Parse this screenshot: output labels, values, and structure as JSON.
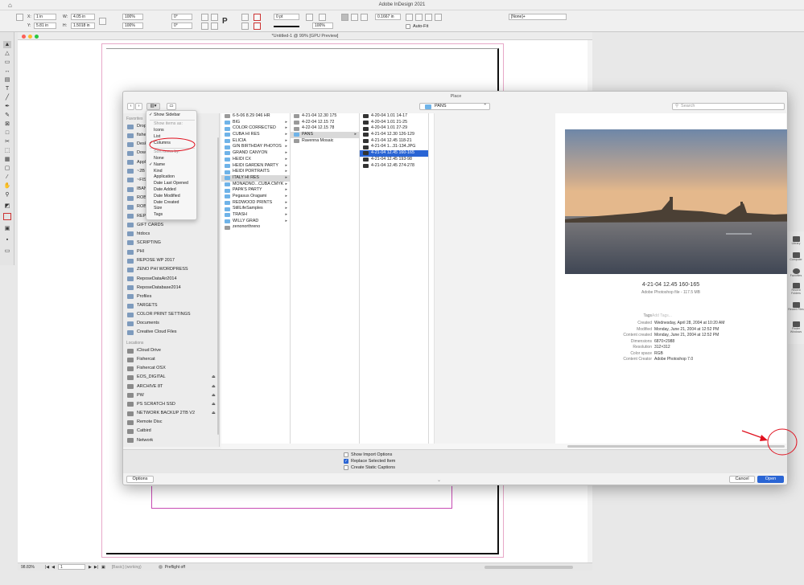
{
  "app": {
    "title": "Adobe InDesign 2021"
  },
  "control": {
    "x": "1 in",
    "y": "5.81 in",
    "w": "4.05 in",
    "h": "1.5018 in",
    "scale_x": "100%",
    "scale_y": "100%",
    "rotate": "0°",
    "shear": "0°",
    "stroke_weight": "0 pt",
    "opacity": "100%",
    "gap": "0.1667 in",
    "style": "[None]+",
    "auto_fit": "Auto-Fit"
  },
  "document": {
    "title": "*Untitled-1 @ 99% [GPU Preview]"
  },
  "status": {
    "zoom": "98.83%",
    "page": "1",
    "style": "[Basic] (working)",
    "preflight": "Preflight off"
  },
  "right_panel": {
    "items": [
      "Library",
      "Computer",
      "Favorites",
      "Recent Folders",
      "Recent Files",
      "Finder Windows"
    ]
  },
  "dialog": {
    "title": "Place",
    "path_popup": "PANS",
    "search_placeholder": "Search",
    "nav": {
      "back": "‹",
      "forward": "›"
    },
    "sidebar": {
      "favorites_header": "Favorites",
      "favorites": [
        "Dropbox",
        "fishercat",
        "Desktop",
        "Downloads",
        "Applications",
        "~2B",
        "~FISHERCAT",
        "IBANEZ",
        "ROBERTS",
        "ROBERTS",
        "REPOSE",
        "GIFT CARDS",
        "htdocs",
        "SCRIPTING",
        "PHI",
        "REPOSE WP 2017",
        "ZENO PHI WORDPRESS",
        "ReposeDataAir2014",
        "ReposeDatabase2014",
        "Profiles",
        "TARGETS",
        "COLOR PRINT SETTINGS",
        "Documents",
        "Creative Cloud Files"
      ],
      "locations_header": "Locations",
      "locations": [
        "iCloud Drive",
        "Fishercat",
        "Fishercat OSX",
        "EOS_DIGITAL",
        "ARCHIVE 8T",
        "PW",
        "PS SCRATCH SSD",
        "NETWORK BACKUP 2TB V2",
        "Remote Disc",
        "Catbird",
        "Network"
      ]
    },
    "col1": [
      "6-5-06 8.29 046 HR",
      "BIG",
      "COLOR CORRECTED",
      "CUBA HI RES",
      "ELICIA",
      "GIN BIRTHDAY PHOTOS",
      "GRAND CANYON",
      "HEIDI CX",
      "HEIDI GARDEN PARTY",
      "HEIDI PORTRAITS",
      "ITALY HI RES",
      "MONADNO...CUBA CMYK",
      "PAPA'S PARTY",
      "Pegasus Oragami",
      "REDWOOD PRINTS",
      "StillLifeSamples",
      "TRASH",
      "WILLY GRAD",
      "zenonorthreno"
    ],
    "col2": [
      "4-21-04 12.30 175",
      "4-22-04 12.15 72",
      "4-22-04 12.15 78",
      "PANS",
      "Ravenna Mosaic"
    ],
    "col3": [
      "4-20-04 1.01 14-17",
      "4-20-04 1.01 21-25",
      "4-20-04 1.01 27-29",
      "4-21-04 12.30 126-129",
      "4-21-04 12.45 118-21",
      "4-21-04 1...31-134.JPG",
      "4-21-04 12.45 160-165",
      "4-21-04 12.45 193-98",
      "4-21-04 12.45 274-278"
    ],
    "preview": {
      "name": "4-21-04 12.45 160-165",
      "kind": "Adobe Photoshop file - 117.5 MB",
      "tags_label": "Tags",
      "tags_placeholder": "Add Tags...",
      "meta": [
        [
          "Created",
          "Wednesday, April 28, 2004 at 10:20 AM"
        ],
        [
          "Modified",
          "Monday, June 21, 2004 at 12:52 PM"
        ],
        [
          "Content created",
          "Monday, June 21, 2004 at 12:52 PM"
        ],
        [
          "Dimensions",
          "6870×2988"
        ],
        [
          "Resolution",
          "312×312"
        ],
        [
          "Color space",
          "RGB"
        ],
        [
          "Content Creator",
          "Adobe Photoshop 7.0"
        ]
      ]
    },
    "checkboxes": {
      "show_import": "Show Import Options",
      "replace": "Replace Selected Item",
      "static": "Create Static Captions"
    },
    "buttons": {
      "options": "Options",
      "cancel": "Cancel",
      "open": "Open"
    }
  },
  "view_menu": {
    "show_sidebar": "Show Sidebar",
    "show_items_header": "Show items as:",
    "icons": "Icons",
    "list": "List",
    "columns": "Columns",
    "sort_header": "Sort items by:",
    "sort": [
      "None",
      "Name",
      "Kind",
      "Application",
      "Date Last Opened",
      "Date Added",
      "Date Modified",
      "Date Created",
      "Size",
      "Tags"
    ]
  },
  "colors": {
    "accent": "#2a65d4",
    "annotation": "#e0101e",
    "margin_guide": "#c84bb4"
  }
}
